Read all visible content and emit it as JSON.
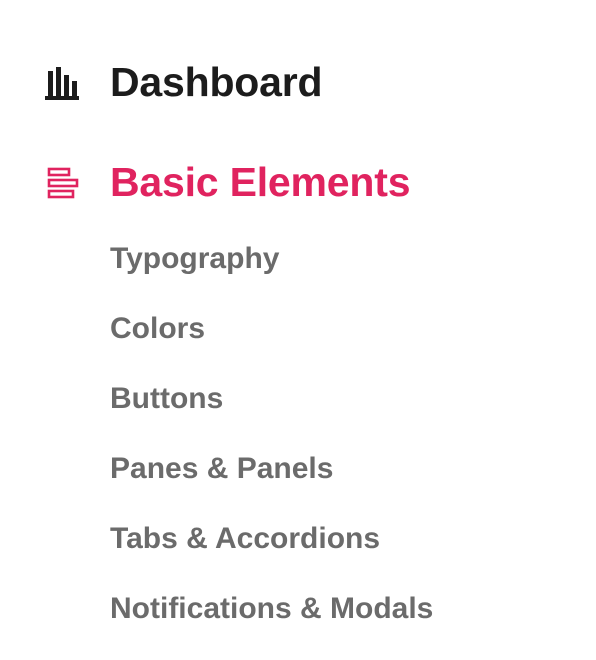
{
  "nav": {
    "dashboard": {
      "label": "Dashboard",
      "icon": "bar-chart-icon"
    },
    "basic_elements": {
      "label": "Basic Elements",
      "icon": "align-left-icon",
      "color": "#e0235f",
      "items": [
        {
          "label": "Typography"
        },
        {
          "label": "Colors"
        },
        {
          "label": "Buttons"
        },
        {
          "label": "Panes & Panels"
        },
        {
          "label": "Tabs & Accordions"
        },
        {
          "label": "Notifications & Modals"
        }
      ]
    }
  },
  "colors": {
    "heading_dark": "#1c1c1c",
    "accent": "#e0235f",
    "subitem": "#6b6b6b"
  }
}
